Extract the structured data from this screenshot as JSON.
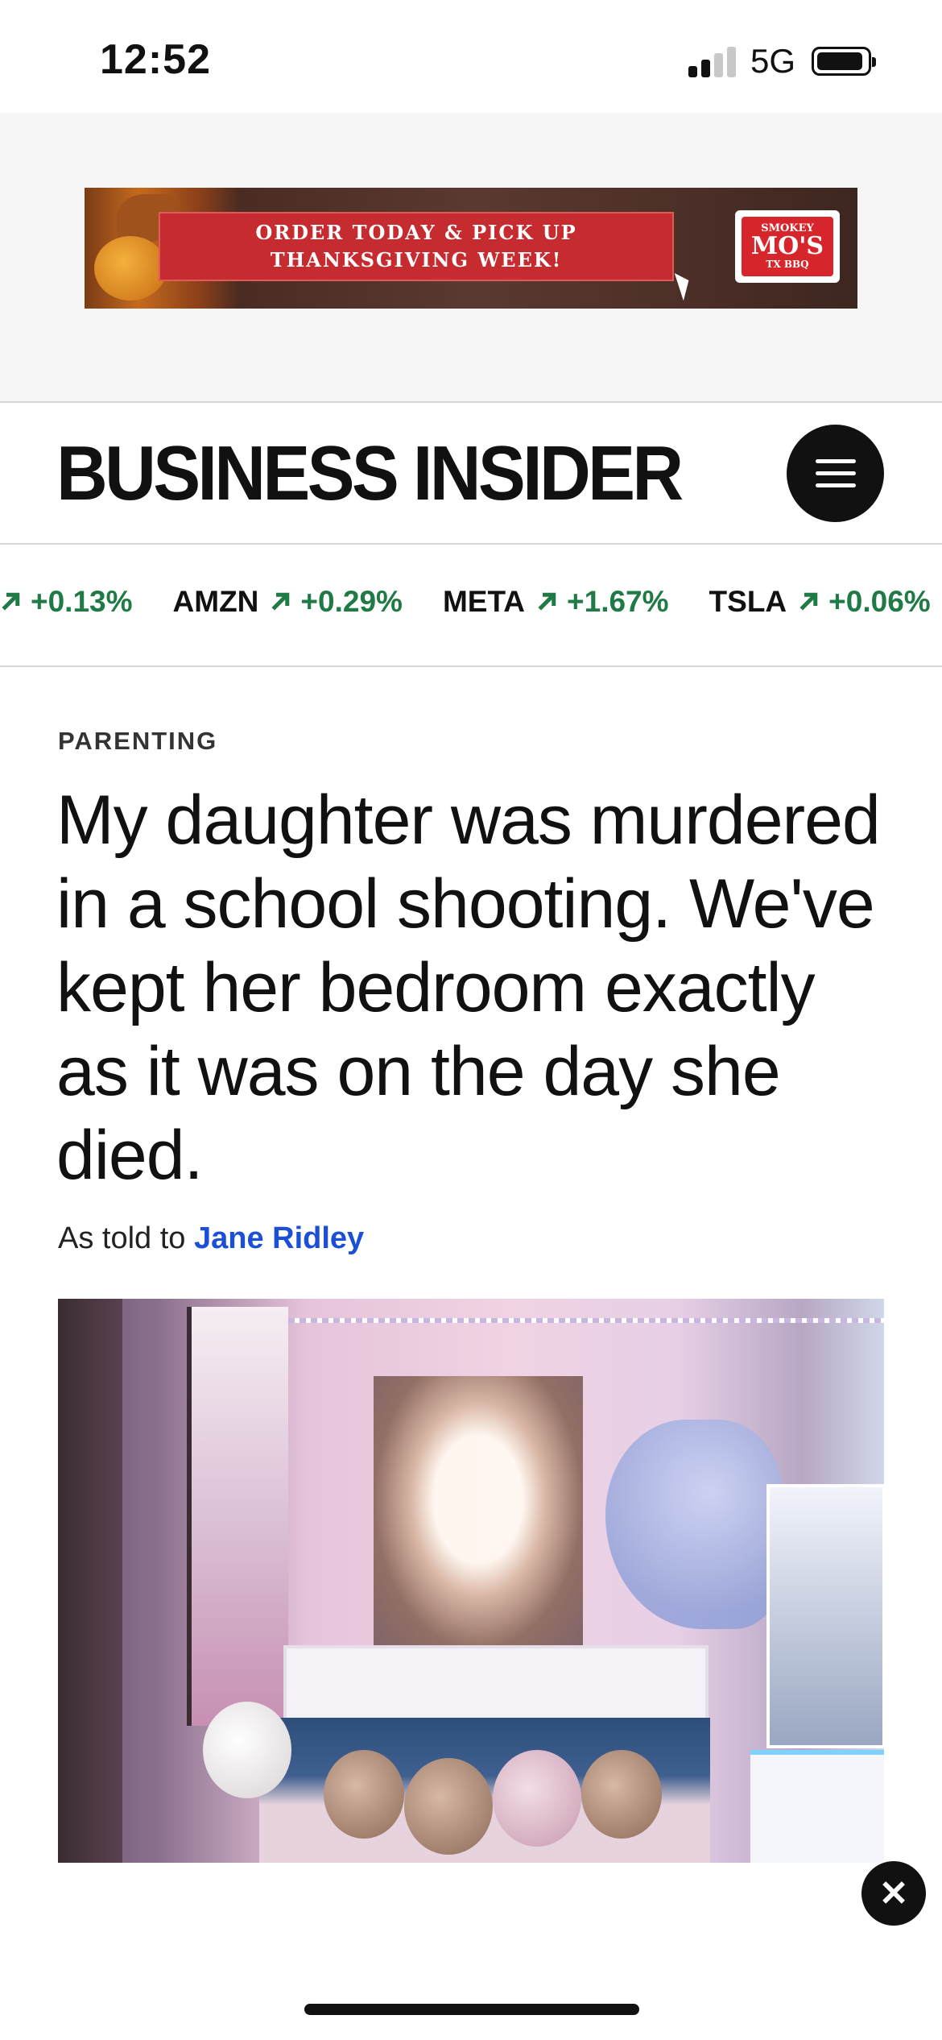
{
  "status_bar": {
    "time": "12:52",
    "network": "5G",
    "signal_bars_active": 2,
    "signal_bars_total": 4,
    "battery_level": 0.9
  },
  "ad": {
    "cta_line1": "ORDER TODAY & PICK UP",
    "cta_line2": "THANKSGIVING WEEK!",
    "logo_line1": "SMOKEY",
    "logo_line2": "MO'S",
    "logo_line3": "TX BBQ"
  },
  "header": {
    "brand": "BUSINESS INSIDER",
    "menu_icon": "hamburger-icon"
  },
  "ticker": [
    {
      "symbol": "",
      "change": "+0.13%",
      "direction": "up"
    },
    {
      "symbol": "AMZN",
      "change": "+0.29%",
      "direction": "up"
    },
    {
      "symbol": "META",
      "change": "+1.67%",
      "direction": "up"
    },
    {
      "symbol": "TSLA",
      "change": "+0.06%",
      "direction": "up"
    }
  ],
  "article": {
    "category": "PARENTING",
    "headline": "My daughter was murdered in a school shooting. We've kept her bedroom exactly as it was on the day she died.",
    "byline_prefix": "As told to",
    "author": "Jane Ridley"
  },
  "overlay": {
    "close_glyph": "✕"
  },
  "colors": {
    "ticker_up": "#1f7a45",
    "author_link": "#1a4fd6",
    "ad_red": "#c62b30"
  }
}
